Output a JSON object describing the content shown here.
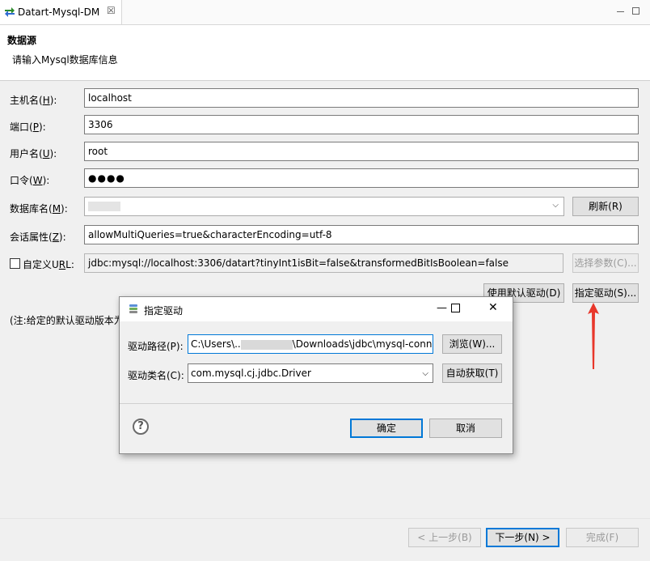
{
  "tab": {
    "title": "Datart-Mysql-DM",
    "close": "☒"
  },
  "header": {
    "title": "数据源",
    "description": "请输入Mysql数据库信息"
  },
  "form": {
    "host": {
      "label": "主机名(",
      "key": "H",
      "suffix": "):",
      "value": "localhost"
    },
    "port": {
      "label": "端口(",
      "key": "P",
      "suffix": "):",
      "value": "3306"
    },
    "user": {
      "label": "用户名(",
      "key": "U",
      "suffix": "):",
      "value": "root"
    },
    "password": {
      "label": "口令(",
      "key": "W",
      "suffix": "):",
      "value": "●●●●"
    },
    "database": {
      "label": "数据库名(",
      "key": "M",
      "suffix": "):",
      "value": ""
    },
    "session": {
      "label": "会话属性(",
      "key": "Z",
      "suffix": "):",
      "value": "allowMultiQueries=true&characterEncoding=utf-8"
    },
    "custom_url": {
      "label": "自定义U",
      "key": "R",
      "suffix": "L:",
      "value": "jdbc:mysql://localhost:3306/datart?tinyInt1isBit=false&transformedBitIsBoolean=false",
      "checked": false
    }
  },
  "buttons": {
    "refresh": "刷新(R)",
    "select_params": "选择参数(C)...",
    "use_default_driver": "使用默认驱动(D)",
    "specify_driver": "指定驱动(S)...",
    "back": "< 上一步(B)",
    "next": "下一步(N) >",
    "finish": "完成(F)"
  },
  "note": "(注:给定的默认驱动版本为",
  "dialog": {
    "title": "指定驱动",
    "path_label": "驱动路径(P):",
    "path_prefix": "C:\\Users\\..",
    "path_suffix": "\\Downloads\\jdbc\\mysql-conne",
    "class_label": "驱动类名(C):",
    "class_value": "com.mysql.cj.jdbc.Driver",
    "browse": "浏览(W)...",
    "auto_fetch": "自动获取(T)",
    "ok": "确定",
    "cancel": "取消",
    "help": "?"
  },
  "colors": {
    "accent": "#0078d7",
    "arrow": "#e8372b"
  }
}
